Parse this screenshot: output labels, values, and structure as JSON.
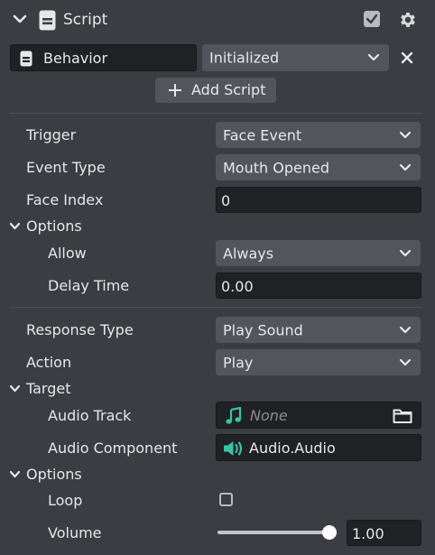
{
  "header": {
    "title": "Script",
    "enabled": true
  },
  "behavior": {
    "name": "Behavior",
    "event_select": "Initialized"
  },
  "add_script_label": "Add Script",
  "fields": {
    "trigger": {
      "label": "Trigger",
      "value": "Face Event"
    },
    "event_type": {
      "label": "Event Type",
      "value": "Mouth Opened"
    },
    "face_index": {
      "label": "Face Index",
      "value": "0"
    }
  },
  "options1": {
    "title": "Options",
    "allow": {
      "label": "Allow",
      "value": "Always"
    },
    "delay_time": {
      "label": "Delay Time",
      "value": "0.00"
    }
  },
  "response": {
    "response_type": {
      "label": "Response Type",
      "value": "Play Sound"
    },
    "action": {
      "label": "Action",
      "value": "Play"
    }
  },
  "target": {
    "title": "Target",
    "audio_track": {
      "label": "Audio Track",
      "value": "None"
    },
    "audio_component": {
      "label": "Audio Component",
      "value": "Audio.Audio"
    }
  },
  "options2": {
    "title": "Options",
    "loop": {
      "label": "Loop",
      "checked": false
    },
    "volume": {
      "label": "Volume",
      "value": "1.00",
      "level": 1.0
    }
  },
  "colors": {
    "panel_bg": "#3a3d42",
    "field_bg": "#1f2124",
    "dropdown_bg": "#52565c",
    "audio_icon": "#35c4a0"
  }
}
